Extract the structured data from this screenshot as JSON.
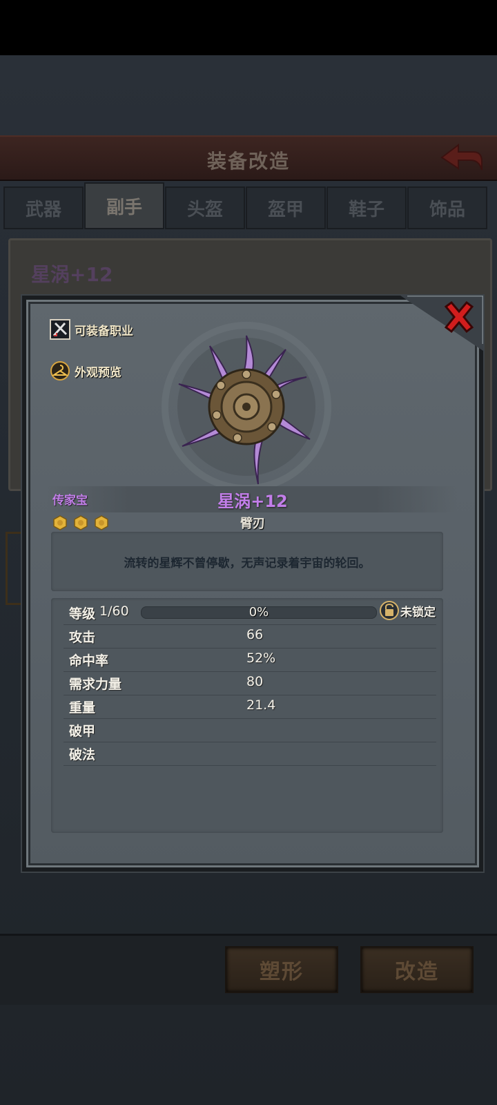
{
  "background_page": {
    "title": "装备改造",
    "tabs": [
      "武器",
      "副手",
      "头盔",
      "盔甲",
      "鞋子",
      "饰品"
    ],
    "active_tab_index": 1,
    "item_name": "星涡+12",
    "buttons": {
      "reshape": "塑形",
      "refit": "改造"
    }
  },
  "modal": {
    "links": {
      "equip_class": "可装备职业",
      "appearance_preview": "外观预览"
    },
    "item": {
      "rarity": "传家宝",
      "name": "星涡+12",
      "type": "臂刃",
      "stars": 3,
      "description": "流转的星辉不曾停歇，无声记录着宇宙的轮回。"
    },
    "stats": {
      "level_label": "等级",
      "level_value": "1/60",
      "xp_percent": 0,
      "xp_text": "0%",
      "lock_text": "未锁定",
      "rows": [
        {
          "label": "攻击",
          "value": "66"
        },
        {
          "label": "命中率",
          "value": "52%"
        },
        {
          "label": "需求力量",
          "value": "80"
        },
        {
          "label": "重量",
          "value": "21.4"
        },
        {
          "label": "破甲",
          "value": ""
        },
        {
          "label": "破法",
          "value": ""
        }
      ]
    },
    "icons": {
      "close": "close-x-icon",
      "equip_class": "crossed-swords-icon",
      "appearance": "hanger-icon",
      "lock": "padlock-icon",
      "star": "gold-hex-star-icon"
    },
    "colors": {
      "rarity_purple": "#c27ee9",
      "close_red": "#d21d1d",
      "star_gold": "#e3b33a"
    }
  }
}
